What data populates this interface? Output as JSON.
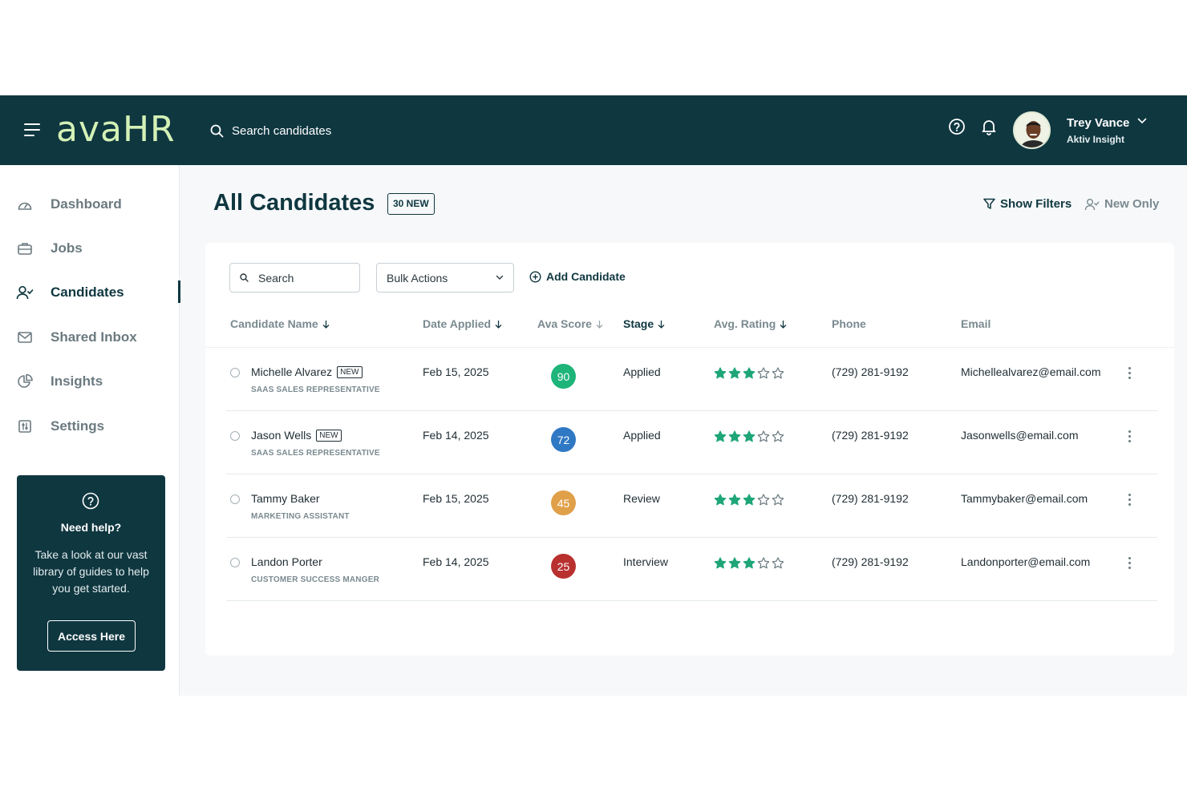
{
  "header": {
    "logo": "avaHR",
    "search_placeholder": "Search candidates",
    "user": {
      "name": "Trey Vance",
      "org": "Aktiv Insight"
    }
  },
  "sidebar": {
    "items": [
      {
        "label": "Dashboard",
        "icon": "gauge-icon"
      },
      {
        "label": "Jobs",
        "icon": "briefcase-icon"
      },
      {
        "label": "Candidates",
        "icon": "user-check-icon",
        "active": true
      },
      {
        "label": "Shared Inbox",
        "icon": "mail-icon"
      },
      {
        "label": "Insights",
        "icon": "pie-chart-icon"
      },
      {
        "label": "Settings",
        "icon": "sliders-icon"
      }
    ],
    "help": {
      "title": "Need help?",
      "text": "Take a look at our vast library of guides to help you get started.",
      "button": "Access Here"
    }
  },
  "main": {
    "title": "All Candidates",
    "new_badge": "30 NEW",
    "show_filters": "Show Filters",
    "new_only": "New Only",
    "toolbar": {
      "search_placeholder": "Search",
      "bulk_actions": "Bulk Actions",
      "add_candidate": "Add Candidate"
    },
    "columns": [
      "Candidate Name",
      "Date Applied",
      "Ava Score",
      "Stage",
      "Avg. Rating",
      "Phone",
      "Email"
    ],
    "new_tag": "NEW",
    "rows": [
      {
        "name": "Michelle Alvarez",
        "is_new": true,
        "role": "SAAS SALES REPRESENTATIVE",
        "date": "Feb 15, 2025",
        "score": 90,
        "score_color": "#1eb47a",
        "stage": "Applied",
        "rating": 3,
        "phone": "(729) 281-9192",
        "email": "Michellealvarez@email.com"
      },
      {
        "name": "Jason Wells",
        "is_new": true,
        "role": "SAAS SALES REPRESENTATIVE",
        "date": "Feb 14, 2025",
        "score": 72,
        "score_color": "#2f78c4",
        "stage": "Applied",
        "rating": 3,
        "phone": "(729) 281-9192",
        "email": "Jasonwells@email.com"
      },
      {
        "name": "Tammy Baker",
        "is_new": false,
        "role": "MARKETING ASSISTANT",
        "date": "Feb 15, 2025",
        "score": 45,
        "score_color": "#e0a04a",
        "stage": "Review",
        "rating": 3,
        "phone": "(729) 281-9192",
        "email": "Tammybaker@email.com"
      },
      {
        "name": "Landon Porter",
        "is_new": false,
        "role": "CUSTOMER SUCCESS MANGER",
        "date": "Feb 14, 2025",
        "score": 25,
        "score_color": "#b8312f",
        "stage": "Interview",
        "rating": 3,
        "phone": "(729) 281-9192",
        "email": "Landonporter@email.com"
      }
    ]
  },
  "colors": {
    "brand": "#0f3740",
    "logo": "#d4f1b6",
    "star": "#1ea679"
  }
}
